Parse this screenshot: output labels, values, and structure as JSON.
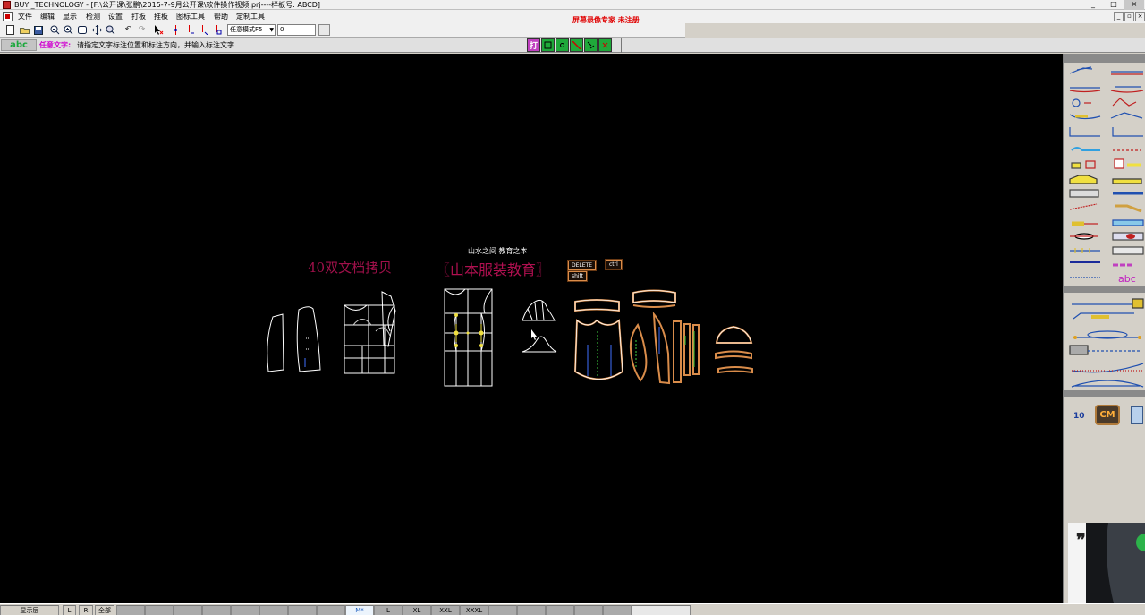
{
  "window": {
    "title": "BUYI_TECHNOLOGY - [F:\\公开课\\张鹏\\2015-7-9月公开课\\软件操作视频.prj----样板号: ABCD]",
    "minimize": "_",
    "restore": "□",
    "close": "×",
    "mdi_minimize": "_",
    "mdi_restore": "▫",
    "mdi_close": "×"
  },
  "menu": {
    "items": [
      "文件",
      "编辑",
      "显示",
      "检测",
      "设置",
      "打板",
      "推板",
      "图标工具",
      "帮助",
      "定制工具"
    ],
    "reg_notice": "屏幕录像专家 未注册"
  },
  "toolbar": {
    "mode_select": "任意模式F5",
    "value_input": "0",
    "icons": [
      "new-file-icon",
      "open-folder-icon",
      "save-icon",
      "zoom-out-icon",
      "zoom-in-icon",
      "zoom-window-icon",
      "pan-icon",
      "zoom-fit-icon",
      "undo-icon",
      "redo-icon",
      "select-cursor-icon",
      "add-point-icon",
      "move-point-icon",
      "cut-point-icon",
      "measure-point-icon"
    ]
  },
  "prompt": {
    "tool_tag": "abc",
    "label": "任意文字:",
    "text": "请指定文字标注位置和标注方向，并输入标注文字...",
    "snap_first": "打",
    "snap_buttons": [
      "snap-endpoint-icon",
      "snap-midpoint-icon",
      "snap-line-icon",
      "snap-intersection-icon",
      "snap-off-icon"
    ]
  },
  "canvas": {
    "watermark_left": "40双文档拷贝",
    "watermark_center": "〖山本服装教育〗",
    "motto": "山水之间   教育之本",
    "keys": [
      "DELETE",
      "ctrl",
      "shift"
    ]
  },
  "right_panel": {
    "abc_tool": "abc",
    "scale_value": "10",
    "unit_button": "CM",
    "tools": [
      "tool-line",
      "tool-offset",
      "tool-arc",
      "tool-angle",
      "tool-circle",
      "tool-curve",
      "tool-dart",
      "tool-pleat",
      "tool-notch",
      "tool-mirror",
      "tool-fold",
      "tool-grain",
      "tool-button",
      "tool-text"
    ]
  },
  "status": {
    "layer_button": "显示层",
    "cells": [
      "L",
      "R",
      "全部"
    ],
    "sizes": [
      "M*",
      "L",
      "XL",
      "XXL",
      "XXXL"
    ]
  },
  "colors": {
    "canvas_bg": "#000000",
    "watermark": "#a0104a",
    "pattern_white": "#ffffff",
    "pattern_orange": "#d98c4a",
    "highlight_yellow": "#f0e040",
    "grain_blue": "#4070ff"
  }
}
